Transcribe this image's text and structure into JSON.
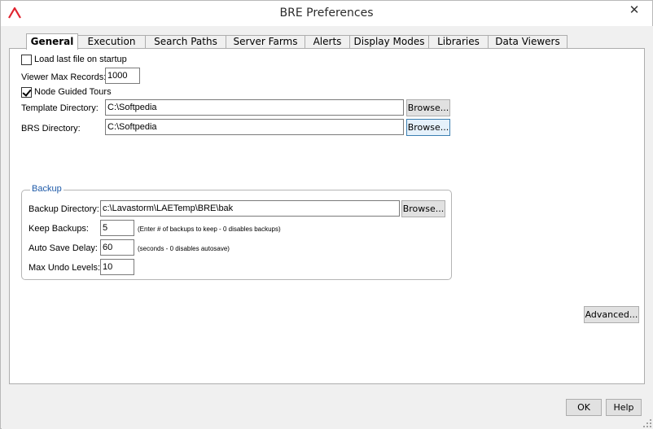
{
  "window": {
    "title": "BRE Preferences",
    "close_glyph": "✕",
    "app_icon": "lavastorm-logo-icon"
  },
  "tabs": [
    {
      "label": "General",
      "active": true
    },
    {
      "label": "Execution",
      "active": false
    },
    {
      "label": "Search Paths",
      "active": false
    },
    {
      "label": "Server Farms",
      "active": false
    },
    {
      "label": "Alerts",
      "active": false
    },
    {
      "label": "Display Modes",
      "active": false
    },
    {
      "label": "Libraries",
      "active": false
    },
    {
      "label": "Data Viewers",
      "active": false
    }
  ],
  "general": {
    "load_last_file": {
      "label": "Load last file on startup",
      "checked": false
    },
    "viewer_max_records": {
      "label": "Viewer Max Records:",
      "value": "1000"
    },
    "node_guided_tours": {
      "label": "Node Guided Tours",
      "checked": true
    },
    "template_directory": {
      "label": "Template Directory:",
      "value": "C:\\Softpedia",
      "button": "Browse..."
    },
    "brs_directory": {
      "label": "BRS Directory:",
      "value": "C:\\Softpedia",
      "button": "Browse..."
    }
  },
  "backup": {
    "title": "Backup",
    "directory": {
      "label": "Backup Directory:",
      "value": "c:\\Lavastorm\\LAETemp\\BRE\\bak",
      "button": "Browse..."
    },
    "keep_backups": {
      "label": "Keep Backups:",
      "value": "5",
      "hint": "(Enter # of backups to keep - 0 disables backups)"
    },
    "auto_save_delay": {
      "label": "Auto Save Delay:",
      "value": "60",
      "hint": "(seconds - 0 disables autosave)"
    },
    "max_undo_levels": {
      "label": "Max Undo Levels:",
      "value": "10"
    }
  },
  "advanced_button": "Advanced...",
  "footer": {
    "ok": "OK",
    "help": "Help"
  },
  "colors": {
    "accent": "#1e5aa8",
    "logo": "#e0242f"
  }
}
